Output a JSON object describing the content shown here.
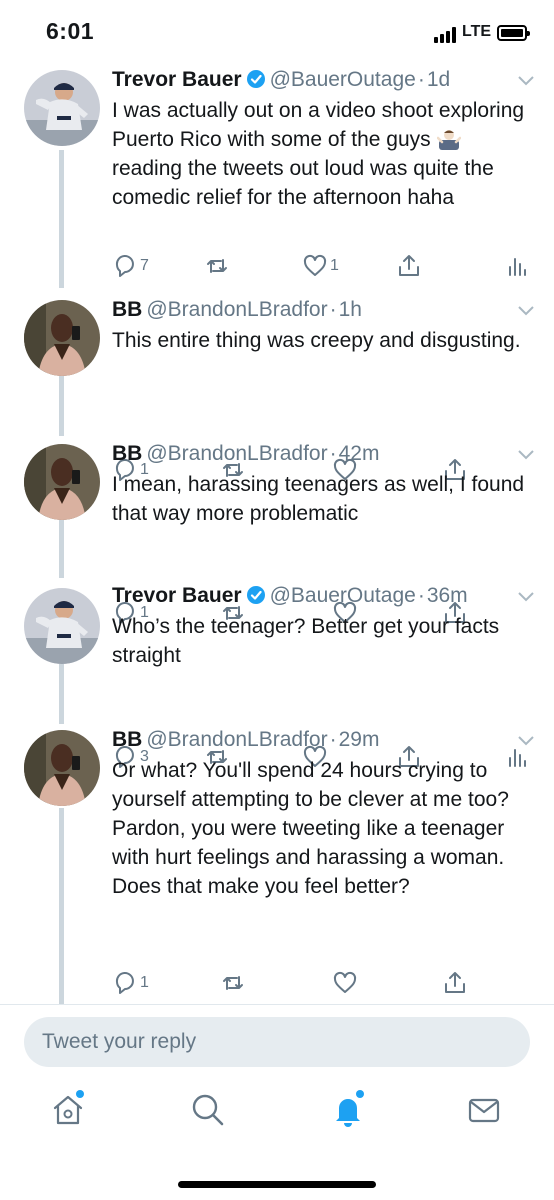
{
  "status_bar": {
    "time": "6:01",
    "network": "LTE"
  },
  "tweets": [
    {
      "name": "Trevor Bauer",
      "verified": true,
      "handle": "@BauerOutage",
      "time": "1d",
      "text_before_emoji": "I was actually out on a video shoot exploring Puerto Rico with some of the guys ",
      "text_after_emoji": " reading the tweets out loud was quite the comedic relief for the afternoon haha",
      "replies": "7",
      "retweets": "",
      "likes": "1",
      "has_analytics": true
    },
    {
      "name": "BB",
      "verified": false,
      "handle": "@BrandonLBradfor",
      "time": "1h",
      "text": "This entire thing was creepy and disgusting.",
      "replies": "1",
      "retweets": "",
      "likes": "",
      "has_analytics": false
    },
    {
      "name": "BB",
      "verified": false,
      "handle": "@BrandonLBradfor",
      "time": "42m",
      "text": "I mean, harassing teenagers as well, I found that way more problematic",
      "replies": "1",
      "retweets": "",
      "likes": "",
      "has_analytics": false
    },
    {
      "name": "Trevor Bauer",
      "verified": true,
      "handle": "@BauerOutage",
      "time": "36m",
      "text": "Who’s the teenager? Better get your facts straight",
      "replies": "3",
      "retweets": "",
      "likes": "",
      "has_analytics": true
    },
    {
      "name": "BB",
      "verified": false,
      "handle": "@BrandonLBradfor",
      "time": "29m",
      "text": "Or what? You'll spend 24 hours crying to yourself attempting to be clever at me too?\nPardon, you were tweeting like a teenager with hurt feelings and harassing a woman. Does that make you feel better?",
      "replies": "1",
      "retweets": "",
      "likes": "",
      "has_analytics": false
    }
  ],
  "reply_bar": {
    "placeholder": "Tweet your reply"
  },
  "bottom_nav": {
    "items": [
      "home-icon",
      "search-icon",
      "notifications-icon",
      "messages-icon"
    ],
    "accent": "#1da1f2"
  },
  "colors": {
    "accent": "#1da1f2",
    "muted": "#657786",
    "thread_line": "#ccd6dd"
  }
}
